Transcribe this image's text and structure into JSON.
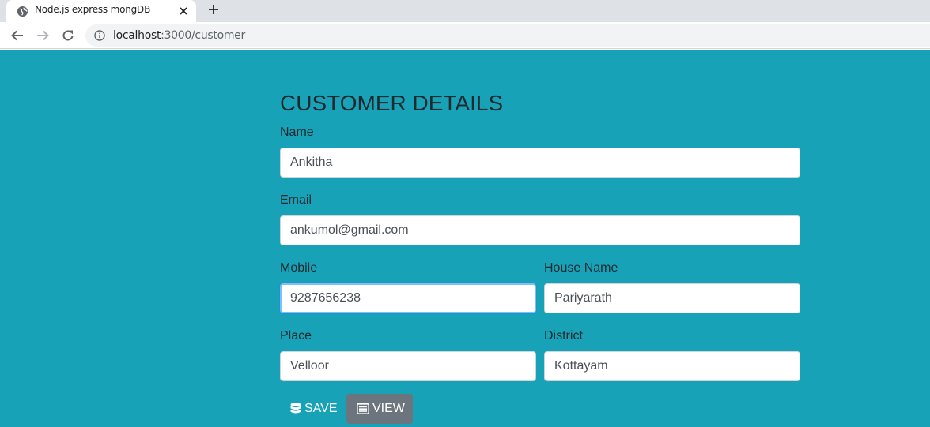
{
  "browser": {
    "tab": {
      "title": "Node.js express mongDB"
    },
    "url": {
      "host": "localhost",
      "path": ":3000/customer"
    },
    "icons": [
      "globe-icon",
      "close-icon",
      "plus-icon",
      "back-arrow-icon",
      "forward-arrow-icon",
      "reload-icon",
      "info-icon"
    ]
  },
  "form": {
    "heading": "CUSTOMER DETAILS",
    "fields": {
      "name": {
        "label": "Name",
        "value": "Ankitha"
      },
      "email": {
        "label": "Email",
        "value": "ankumol@gmail.com"
      },
      "mobile": {
        "label": "Mobile",
        "value": "9287656238"
      },
      "house_name": {
        "label": "House Name",
        "value": "Pariyarath"
      },
      "place": {
        "label": "Place",
        "value": "Velloor"
      },
      "district": {
        "label": "District",
        "value": "Kottayam"
      }
    },
    "buttons": {
      "save_label": "SAVE",
      "view_label": "VIEW"
    }
  },
  "colors": {
    "page_background": "#18a2b8",
    "view_button": "#6c757d",
    "focus_border": "#80bdff"
  }
}
